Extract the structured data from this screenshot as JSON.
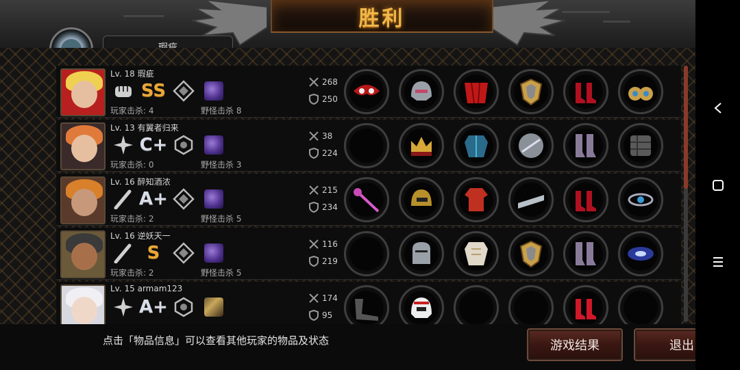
{
  "header": {
    "title": "胜利",
    "tab_label": "瑕疵"
  },
  "hint_text": "点击「物品信息」可以查看其他玩家的物品及状态",
  "buttons": {
    "result": "游戏结果",
    "exit": "退出"
  },
  "players": [
    {
      "level": "Lv. 18",
      "name": "瑕疵",
      "weapon_icon": "fist-icon",
      "rank": "SS",
      "rank_color": "#e8a838",
      "player_kills": "玩家击杀: 4",
      "monster_kills": "野怪击杀 8",
      "attack": "268",
      "defense": "250",
      "items": [
        "red-winged-mask-icon",
        "steel-helmet-icon",
        "red-cape-icon",
        "gold-shield-icon",
        "red-heels-icon",
        "gold-earrings-icon"
      ]
    },
    {
      "level": "Lv. 13",
      "name": "有翼者归来",
      "weapon_icon": "shuriken-icon",
      "rank": "C+",
      "rank_color": "#d8dde8",
      "player_kills": "玩家击杀: 0",
      "monster_kills": "野怪击杀 3",
      "attack": "38",
      "defense": "224",
      "items": [
        "",
        "gold-crown-icon",
        "blue-armor-icon",
        "round-disc-icon",
        "purple-boots-icon",
        "stone-gauntlet-icon"
      ]
    },
    {
      "level": "Lv. 16",
      "name": "醉知酒浓",
      "weapon_icon": "bat-icon",
      "rank": "A+",
      "rank_color": "#d8dde8",
      "player_kills": "玩家击杀: 2",
      "monster_kills": "野怪击杀 5",
      "attack": "215",
      "defense": "234",
      "items": [
        "pink-staff-icon",
        "gold-helmet-icon",
        "red-jacket-icon",
        "silver-bracer-icon",
        "red-heels-icon",
        "blue-gem-bracelet-icon"
      ]
    },
    {
      "level": "Lv. 16",
      "name": "逆妖天一",
      "weapon_icon": "bat-icon",
      "rank": "S",
      "rank_color": "#e8a838",
      "player_kills": "玩家击杀: 2",
      "monster_kills": "野怪击杀 5",
      "attack": "116",
      "defense": "219",
      "items": [
        "",
        "knight-helmet-icon",
        "white-armor-icon",
        "gold-shield-icon",
        "purple-boots-icon",
        "galaxy-ring-icon"
      ]
    },
    {
      "level": "Lv. 15",
      "name": "armam123",
      "weapon_icon": "shuriken-icon",
      "rank": "A+",
      "rank_color": "#d8dde8",
      "player_kills": "",
      "monster_kills": "",
      "attack": "174",
      "defense": "95",
      "items": [
        "boomerang-icon",
        "racing-helmet-icon",
        "",
        "",
        "red-heels-icon",
        ""
      ]
    }
  ]
}
